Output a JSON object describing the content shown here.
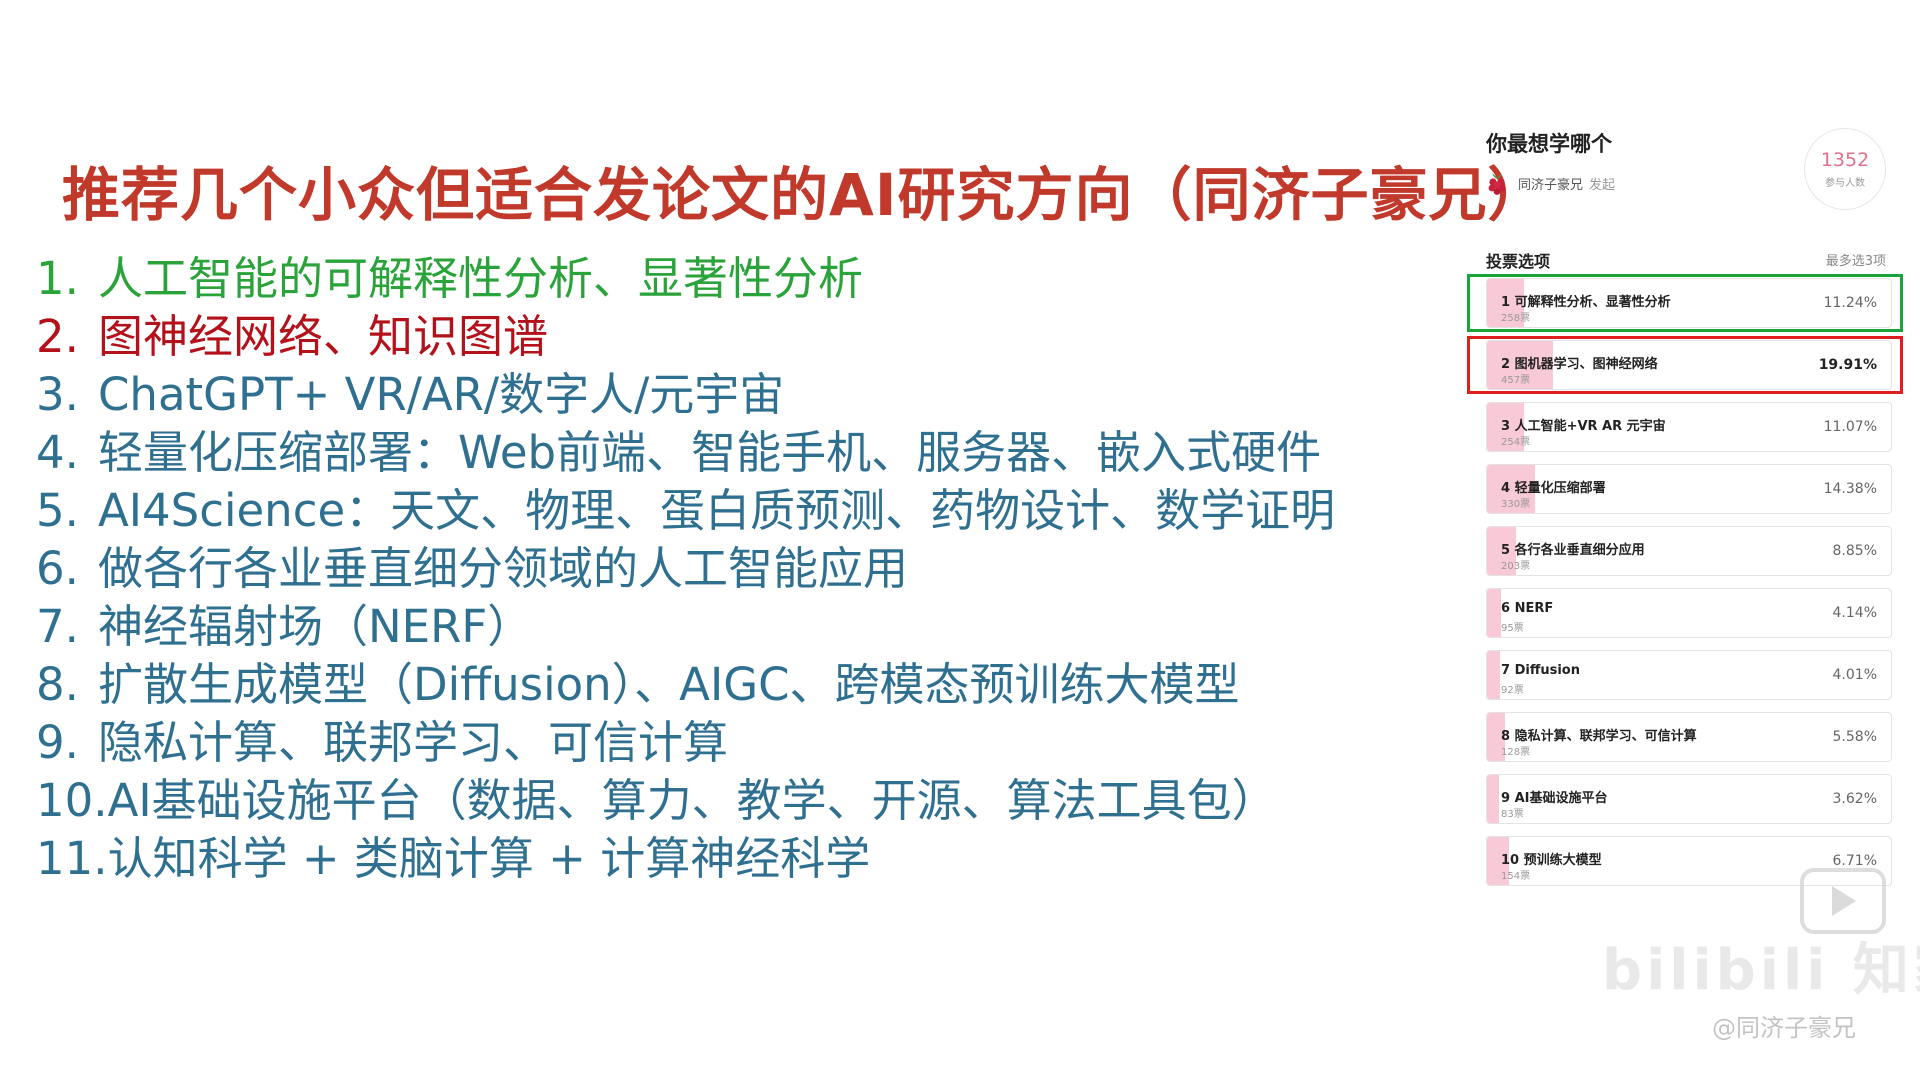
{
  "slide": {
    "title": "推荐几个小众但适合发论文的AI研究方向（同济子豪兄）",
    "topics": [
      {
        "num": "1.",
        "text": "人工智能的可解释性分析、显著性分析",
        "color": "#2aa33a"
      },
      {
        "num": "2.",
        "text": "图神经网络、知识图谱",
        "color": "#b3121a"
      },
      {
        "num": "3.",
        "text": "ChatGPT+ VR/AR/数字人/元宇宙",
        "color": "#2f6f90"
      },
      {
        "num": "4.",
        "text": "轻量化压缩部署：Web前端、智能手机、服务器、嵌入式硬件",
        "color": "#2f6f90"
      },
      {
        "num": "5.",
        "text": "AI4Science：天文、物理、蛋白质预测、药物设计、数学证明",
        "color": "#2f6f90"
      },
      {
        "num": "6.",
        "text": "做各行各业垂直细分领域的人工智能应用",
        "color": "#2f6f90"
      },
      {
        "num": "7.",
        "text": "神经辐射场（NERF）",
        "color": "#2f6f90"
      },
      {
        "num": "8.",
        "text": "扩散生成模型（Diffusion）、AIGC、跨模态预训练大模型",
        "color": "#2f6f90"
      },
      {
        "num": "9.",
        "text": "隐私计算、联邦学习、可信计算",
        "color": "#2f6f90"
      },
      {
        "num": "10.",
        "text": "AI基础设施平台（数据、算力、教学、开源、算法工具包）",
        "color": "#2f6f90"
      },
      {
        "num": "11.",
        "text": "认知科学 + 类脑计算 + 计算神经科学",
        "color": "#2f6f90"
      }
    ]
  },
  "poll": {
    "title": "你最想学哪个",
    "author": "同济子豪兄",
    "initiated": "发起",
    "author_icon": "raspberry-icon",
    "participants": "1352",
    "participants_label": "参与人数",
    "section_label": "投票选项",
    "limit": "最多选3项",
    "options": [
      {
        "name": "1 可解释性分析、显著性分析",
        "votes": "258票",
        "pct": "11.24%",
        "fill": 0.1124
      },
      {
        "name": "2 图机器学习、图神经网络",
        "votes": "457票",
        "pct": "19.91%",
        "fill": 0.1991
      },
      {
        "name": "3 人工智能+VR AR 元宇宙",
        "votes": "254票",
        "pct": "11.07%",
        "fill": 0.1107
      },
      {
        "name": "4 轻量化压缩部署",
        "votes": "330票",
        "pct": "14.38%",
        "fill": 0.1438
      },
      {
        "name": "5 各行各业垂直细分应用",
        "votes": "203票",
        "pct": "8.85%",
        "fill": 0.0885
      },
      {
        "name": "6 NERF",
        "votes": "95票",
        "pct": "4.14%",
        "fill": 0.0414
      },
      {
        "name": "7 Diffusion",
        "votes": "92票",
        "pct": "4.01%",
        "fill": 0.0401
      },
      {
        "name": "8 隐私计算、联邦学习、可信计算",
        "votes": "128票",
        "pct": "5.58%",
        "fill": 0.0558
      },
      {
        "name": "9 AI基础设施平台",
        "votes": "83票",
        "pct": "3.62%",
        "fill": 0.0362
      },
      {
        "name": "10 预训练大模型",
        "votes": "154票",
        "pct": "6.71%",
        "fill": 0.0671
      }
    ]
  },
  "watermark": {
    "logo": "bilibili 知家",
    "user": "@同济子豪兄",
    "play_icon": "play-icon"
  }
}
